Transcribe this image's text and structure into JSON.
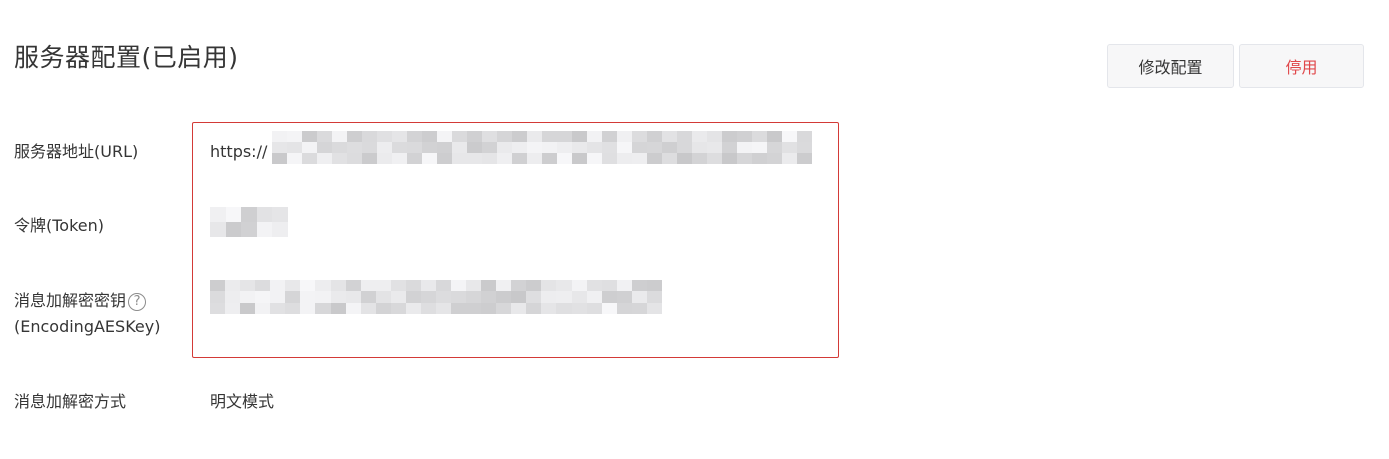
{
  "header": {
    "title": "服务器配置(已启用)",
    "modify_label": "修改配置",
    "disable_label": "停用"
  },
  "fields": {
    "url_label": "服务器地址(URL)",
    "url_prefix": "https://",
    "token_label": "令牌(Token)",
    "aes_label_line1": "消息加解密密钥",
    "aes_label_line2": "(EncodingAESKey)",
    "help_glyph": "?",
    "mode_label": "消息加解密方式",
    "mode_value": "明文模式"
  },
  "colors": {
    "accent_red": "#d33a37",
    "disable_text": "#e0474a",
    "text": "#353535"
  }
}
